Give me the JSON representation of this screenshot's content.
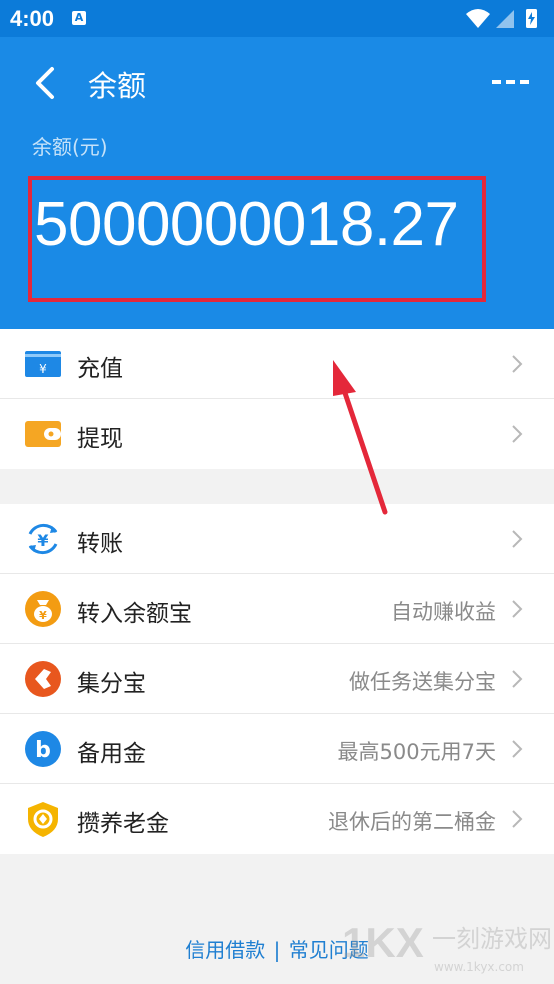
{
  "status_bar": {
    "time": "4:00",
    "notification_letter": "A"
  },
  "header": {
    "title": "余额",
    "balance_label": "余额(元)",
    "balance_amount": "5000000018.27"
  },
  "list_group_1": [
    {
      "label": "充值",
      "icon": "recharge-card-icon",
      "sub": ""
    },
    {
      "label": "提现",
      "icon": "wallet-icon",
      "sub": ""
    }
  ],
  "list_group_2": [
    {
      "label": "转账",
      "icon": "transfer-yuan-icon",
      "sub": ""
    },
    {
      "label": "转入余额宝",
      "icon": "money-bag-icon",
      "sub": "自动赚收益"
    },
    {
      "label": "集分宝",
      "icon": "jifenbao-icon",
      "sub": "做任务送集分宝"
    },
    {
      "label": "备用金",
      "icon": "beiyongjin-icon",
      "sub": "最高500元用7天"
    },
    {
      "label": "攒养老金",
      "icon": "pension-shield-icon",
      "sub": "退休后的第二桶金"
    }
  ],
  "footer": {
    "link1": "信用借款",
    "separator": "|",
    "link2": "常见问题"
  },
  "watermark": {
    "brand": "1KX",
    "text_cn": "一刻游戏网",
    "url": "www.1kyx.com"
  },
  "colors": {
    "header_blue": "#1a8ae6",
    "status_blue": "#0c7bd9",
    "highlight_red": "#e4283a"
  }
}
